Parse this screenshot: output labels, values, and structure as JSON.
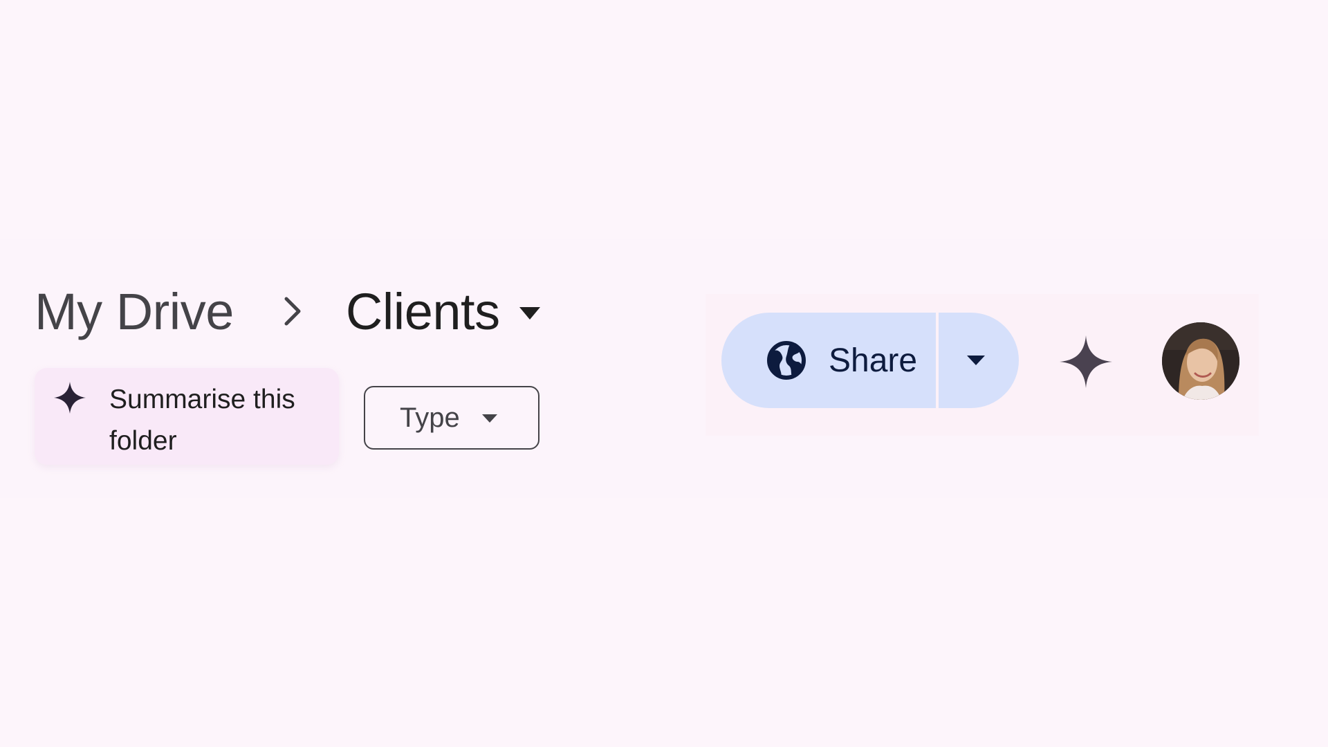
{
  "breadcrumb": {
    "root_label": "My Drive",
    "separator_icon": "chevron-right-icon",
    "current_label": "Clients",
    "current_caret_icon": "caret-down-icon"
  },
  "summarise": {
    "label": "Summarise this folder",
    "icon": "sparkle-icon"
  },
  "filters": {
    "type_label": "Type",
    "type_caret_icon": "caret-down-icon"
  },
  "share": {
    "label": "Share",
    "icon": "globe-icon",
    "dropdown_icon": "caret-down-icon"
  },
  "gemini": {
    "icon": "gemini-sparkle-icon"
  },
  "account": {
    "avatar_icon": "user-avatar-photo"
  },
  "colors": {
    "background": "#fdf5fb",
    "share_button": "#d6e0fb",
    "summarise_chip": "#f9e9f8",
    "text_primary": "#1f1f1f",
    "text_secondary": "#444348"
  }
}
